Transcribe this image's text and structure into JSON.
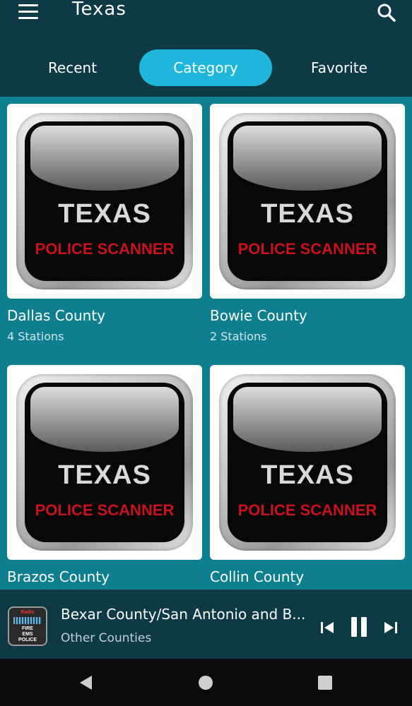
{
  "app_bar": {
    "title": "Texas",
    "menu_icon": "menu-icon",
    "search_icon": "search-icon"
  },
  "tabs": [
    {
      "label": "Recent",
      "active": false
    },
    {
      "label": "Category",
      "active": true
    },
    {
      "label": "Favorite",
      "active": false
    }
  ],
  "logo": {
    "line1": "TEXAS",
    "line2": "POLICE SCANNER"
  },
  "cards": [
    {
      "title": "Dallas County",
      "subtitle": "4 Stations"
    },
    {
      "title": "Bowie County",
      "subtitle": "2 Stations"
    },
    {
      "title": "Brazos County",
      "subtitle": ""
    },
    {
      "title": "Collin County",
      "subtitle": ""
    }
  ],
  "player": {
    "thumb_lines": [
      "Radio",
      "FIRE",
      "EMS",
      "POLICE"
    ],
    "title": "Bexar County/San Antonio and B...",
    "subtitle": "Other Counties",
    "controls": [
      "skip-previous-icon",
      "pause-icon",
      "skip-next-icon"
    ]
  },
  "system_nav": [
    "back-icon",
    "home-icon",
    "recents-icon"
  ],
  "colors": {
    "app_bar": "#0e3a46",
    "content_bg": "#0d7f8f",
    "active_tab": "#1fb6db",
    "logo_red": "#c8121c"
  }
}
